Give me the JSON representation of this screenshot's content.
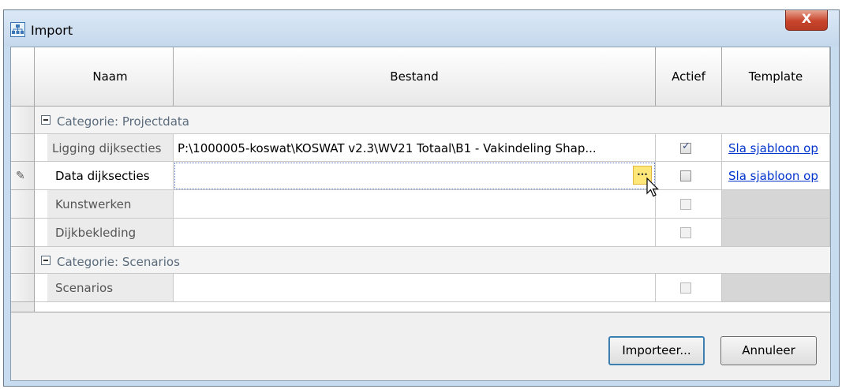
{
  "window": {
    "title": "Import"
  },
  "title_bar": {
    "close_label": "X"
  },
  "grid": {
    "columns": [
      "Naam",
      "Bestand",
      "Actief",
      "Template"
    ],
    "categories": [
      {
        "label": "Categorie: Projectdata"
      },
      {
        "label": "Categorie: Scenarios"
      }
    ],
    "rows": [
      {
        "name": "Ligging dijksecties",
        "file": "P:\\1000005-koswat\\KOSWAT v2.3\\WV21 Totaal\\B1 - Vakindeling Shap...",
        "active": true,
        "template": "Sla sjabloon op"
      },
      {
        "name": "Data dijksecties",
        "file": "",
        "active": false,
        "template": "Sla sjabloon op",
        "editing": true,
        "ellipsis": "..."
      },
      {
        "name": "Kunstwerken",
        "file": "",
        "active": false,
        "template": ""
      },
      {
        "name": "Dijkbekleding",
        "file": "",
        "active": false,
        "template": ""
      },
      {
        "name": "Scenarios",
        "file": "",
        "active": false,
        "template": ""
      }
    ]
  },
  "buttons": {
    "import_label": "Importeer...",
    "cancel_label": "Annuleer"
  }
}
